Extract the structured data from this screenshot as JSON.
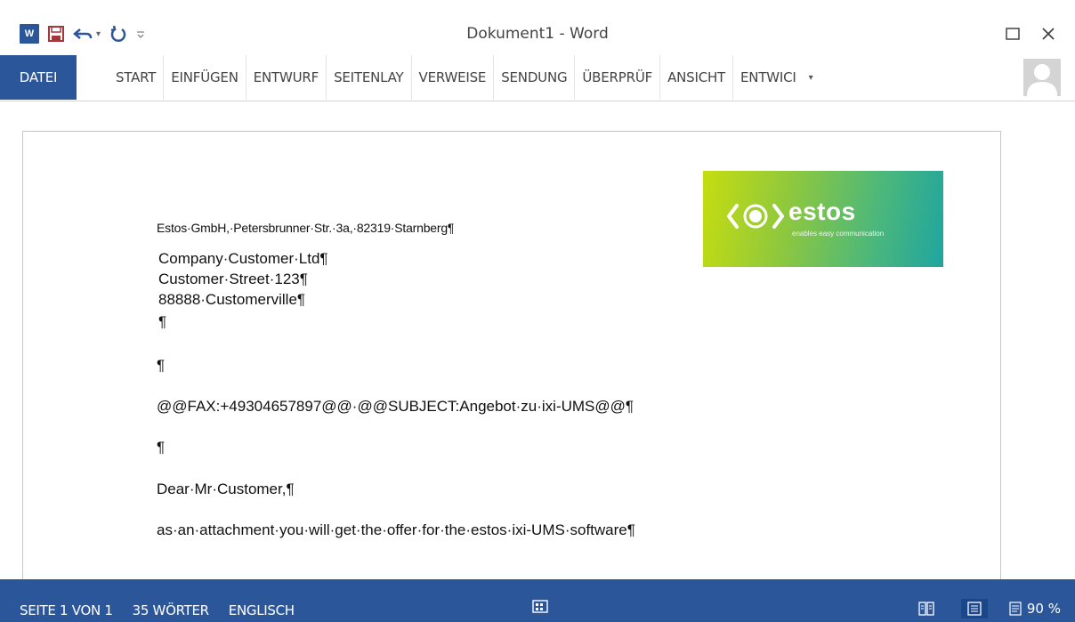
{
  "window": {
    "title": "Dokument1 - Word",
    "accent_color": "#2b579a"
  },
  "qat": {
    "word_icon": "word-icon",
    "word_icon_letters": "W",
    "save_icon": "save-icon",
    "undo_icon": "undo-icon",
    "redo_icon": "redo-icon",
    "customize_icon": "customize-icon"
  },
  "ribbon": {
    "tabs": [
      {
        "label": "DATEI"
      },
      {
        "label": "START"
      },
      {
        "label": "EINFÜGEN"
      },
      {
        "label": "ENTWURF"
      },
      {
        "label": "SEITENLAY"
      },
      {
        "label": "VERWEISE"
      },
      {
        "label": "SENDUNG"
      },
      {
        "label": "ÜBERPRÜF"
      },
      {
        "label": "ANSICHT"
      },
      {
        "label": "ENTWICI"
      }
    ]
  },
  "document": {
    "sender_line": "Estos·GmbH,·Petersbrunner·Str.·3a,·82319·Starnberg¶",
    "address": [
      "Company·Customer·Ltd¶",
      "Customer·Street·123¶",
      "88888·Customerville¶",
      "¶"
    ],
    "paragraphs": [
      "¶",
      "@@FAX:+49304657897@@·@@SUBJECT:Angebot·zu·ixi-UMS@@¶",
      "¶",
      "Dear·Mr·Customer,¶",
      "as·an·attachment·you·will·get·the·offer·for·the·estos·ixi-UMS·software¶"
    ],
    "logo": {
      "wordmark": "estos",
      "tagline": "enables easy communication"
    }
  },
  "statusbar": {
    "page": "SEITE 1 VON 1",
    "words": "35 WÖRTER",
    "language": "ENGLISCH",
    "zoom": "90 %"
  }
}
